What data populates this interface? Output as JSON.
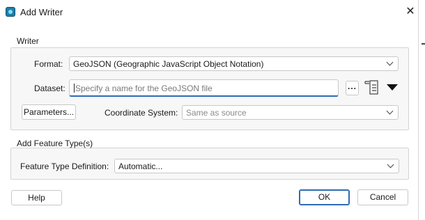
{
  "window": {
    "title": "Add Writer",
    "close_icon": "close-icon",
    "app_icon": "fme-icon"
  },
  "writer": {
    "group_label": "Writer",
    "format": {
      "label": "Format:",
      "value": "GeoJSON (Geographic JavaScript Object Notation)"
    },
    "dataset": {
      "label": "Dataset:",
      "placeholder": "Specify a name for the GeoJSON file",
      "browse_label": "...",
      "browse_icon": "folder-browse-icon",
      "options_icon": "dropdown-arrow-icon"
    },
    "parameters_button": "Parameters...",
    "coordinate_system": {
      "label": "Coordinate System:",
      "value": "Same as source"
    }
  },
  "feature_types": {
    "group_label": "Add Feature Type(s)",
    "definition": {
      "label": "Feature Type Definition:",
      "value": "Automatic..."
    }
  },
  "footer": {
    "help": "Help",
    "ok": "OK",
    "cancel": "Cancel"
  },
  "colors": {
    "accent": "#2e6bb5",
    "background": "#f7f7f7"
  }
}
